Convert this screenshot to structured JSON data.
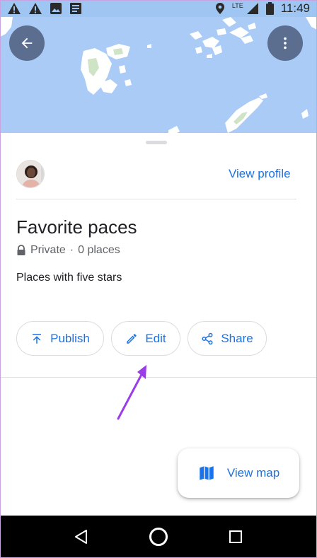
{
  "status_bar": {
    "time": "11:49",
    "network": "LTE",
    "icons_left": [
      "warning-icon",
      "warning-icon",
      "image-icon",
      "news-icon"
    ],
    "icons_right": [
      "location-icon",
      "signal-icon",
      "battery-icon"
    ]
  },
  "map": {
    "background": "#a9cbf5",
    "land_color": "#ffffff",
    "green_color": "#cfe3c5"
  },
  "sheet": {
    "view_profile_label": "View profile",
    "list_title": "Favorite paces",
    "privacy": "Private",
    "separator": "·",
    "place_count": "0 places",
    "description": "Places with five stars",
    "actions": {
      "publish": "Publish",
      "edit": "Edit",
      "share": "Share"
    },
    "fab_label": "View map"
  },
  "colors": {
    "accent": "#1a73e8",
    "annotation_arrow": "#9b3de8",
    "map_button_bg": "#5b6e90"
  }
}
